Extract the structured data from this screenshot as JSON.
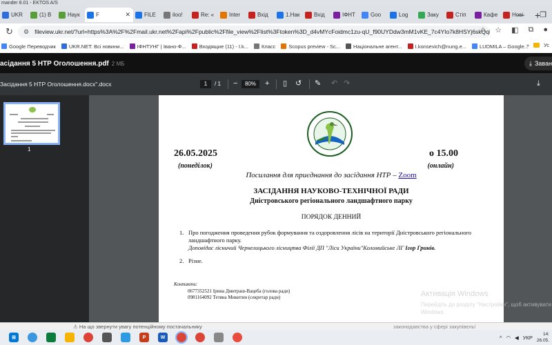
{
  "window": {
    "title": "mander 8.01 - EKTOS A/S"
  },
  "tabs": [
    {
      "label": "UKR",
      "color": "#2d6cdf"
    },
    {
      "label": "(1) В",
      "color": "#5a9e3a"
    },
    {
      "label": "Наук",
      "color": "#5a9e3a"
    },
    {
      "label": "F",
      "color": "#1a73e8",
      "active": true
    },
    {
      "label": "FILE",
      "color": "#1a73e8"
    },
    {
      "label": "iloo!",
      "color": "#777"
    },
    {
      "label": "Re: «",
      "color": "#c5221f"
    },
    {
      "label": "Inter",
      "color": "#e37400"
    },
    {
      "label": "Вхід",
      "color": "#c5221f"
    },
    {
      "label": "1.Нак",
      "color": "#1a73e8"
    },
    {
      "label": "Вхід",
      "color": "#c5221f"
    },
    {
      "label": "ІФНТ",
      "color": "#7b1fa2"
    },
    {
      "label": "Goo",
      "color": "#4285f4"
    },
    {
      "label": "Log",
      "color": "#1a73e8"
    },
    {
      "label": "Заку",
      "color": "#34a853"
    },
    {
      "label": "Стіп",
      "color": "#c5221f"
    },
    {
      "label": "Кафе",
      "color": "#7b1fa2"
    },
    {
      "label": "Нові",
      "color": "#c5221f"
    }
  ],
  "address": {
    "url": "fileview.ukr.net/?url=https%3A%2F%2Fmail.ukr.net%2Fapi%2Fpublic%2Ffile_view%2Flist%3Ftoken%3D_d4vMYcFoidmc1zu-qU_f90UYDdw3mM1vKE_7c4YIo7k8HSYj6skQqDSCxP..."
  },
  "bookmarks": [
    {
      "label": "Google Переводчик",
      "color": "#4285f4"
    },
    {
      "label": "UKR.NET: Всі новини...",
      "color": "#2d6cdf"
    },
    {
      "label": "ІФНТУНГ | Івано-Ф...",
      "color": "#7b1fa2"
    },
    {
      "label": "Входящие (11) - I.k...",
      "color": "#c5221f"
    },
    {
      "label": "Класс",
      "color": "#777"
    },
    {
      "label": "Scopus preview - Sc...",
      "color": "#e37400"
    },
    {
      "label": "Національне агент...",
      "color": "#555"
    },
    {
      "label": "I.konsevich@nung.e...",
      "color": "#c5221f"
    },
    {
      "label": "LUDMILA – Google...",
      "color": "#4285f4"
    }
  ],
  "bookmarks_right": {
    "chevron": "»",
    "folder": "Ус"
  },
  "viewer": {
    "filename": "асідання 5 НТР Оголошення.pdf",
    "filesize": "2 МБ",
    "download_label": "Заван"
  },
  "toolbar": {
    "doc_title": "Засідання 5 НТР Оголошення.docx\".docx",
    "page_current": "1",
    "page_total": "/ 1",
    "zoom": "80%",
    "minus": "−",
    "plus": "+"
  },
  "thumbnail": {
    "number": "1"
  },
  "document": {
    "date": "26.05.2025",
    "time": "о 15.00",
    "weekday": "(понеділок)",
    "mode": "(онлайн)",
    "zoom_text": "Посилання для приєднання до засідання НТР – ",
    "zoom_link": "Zoom",
    "heading": "ЗАСІДАННЯ НАУКОВО-ТЕХНІЧНОЇ РАДИ",
    "subheading": "Дністровського регіонального ландшафтного парку",
    "agenda_title": "ПОРЯДОК ДЕННИЙ",
    "items": [
      {
        "num": "1.",
        "text": "Про погодження проведення рубок формування та оздоровлення лісів на території Дністровського  регіонального ландшафтного парку.",
        "report": "Доповідає лісничий Чернелицького лісництва Філії ДП \"Ліси України\"Коломийське ЛГ",
        "speaker": "Ігор Гринів."
      },
      {
        "num": "2.",
        "text": "Різне."
      }
    ],
    "contacts_label": "Контакти:",
    "contacts": [
      "0677352521 Ірина Дмитраш-Вацеба (голова ради)",
      "0981164092 Тетяна Микитин (секретар ради)"
    ]
  },
  "watermark": {
    "title": "Активація Windows",
    "text": "Перейдіть до розділу \"Настройки\", щоб активувати Windows."
  },
  "bottom": {
    "note": "На що звернути увагу потенційному постачальнику",
    "note2": "законодавства у сфері закупівель!"
  },
  "tray": {
    "lang": "УКР",
    "time": "14:",
    "date": "26.05."
  },
  "colors": {
    "accent": "#8ab4f8",
    "canvas": "#525659",
    "toolbar": "#323639"
  }
}
